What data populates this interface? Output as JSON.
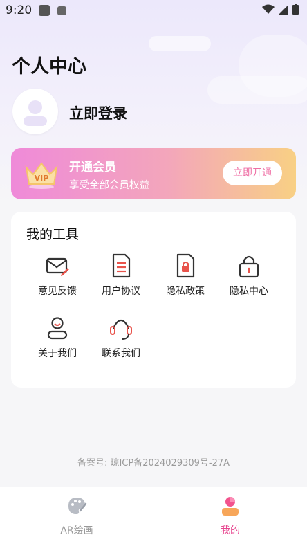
{
  "status_bar": {
    "time": "9:20"
  },
  "header": {
    "title": "个人中心"
  },
  "profile": {
    "login_label": "立即登录"
  },
  "vip": {
    "title": "开通会员",
    "subtitle": "享受全部会员权益",
    "button_label": "立即开通",
    "badge_text": "VIP"
  },
  "tools": {
    "title": "我的工具",
    "items": [
      {
        "label": "意见反馈",
        "icon": "mail-edit-icon"
      },
      {
        "label": "用户协议",
        "icon": "document-icon"
      },
      {
        "label": "隐私政策",
        "icon": "file-lock-icon"
      },
      {
        "label": "隐私中心",
        "icon": "lock-icon"
      },
      {
        "label": "关于我们",
        "icon": "user-icon"
      },
      {
        "label": "联系我们",
        "icon": "headset-icon"
      }
    ]
  },
  "footer": {
    "icp": "备案号: 琼ICP备2024029309号-27A"
  },
  "tabbar": {
    "items": [
      {
        "label": "AR绘画",
        "icon": "palette-icon",
        "active": false
      },
      {
        "label": "我的",
        "icon": "profile-icon",
        "active": true
      }
    ]
  },
  "colors": {
    "accent": "#e7458f",
    "icon_red": "#e8534b",
    "inactive": "#999999"
  }
}
